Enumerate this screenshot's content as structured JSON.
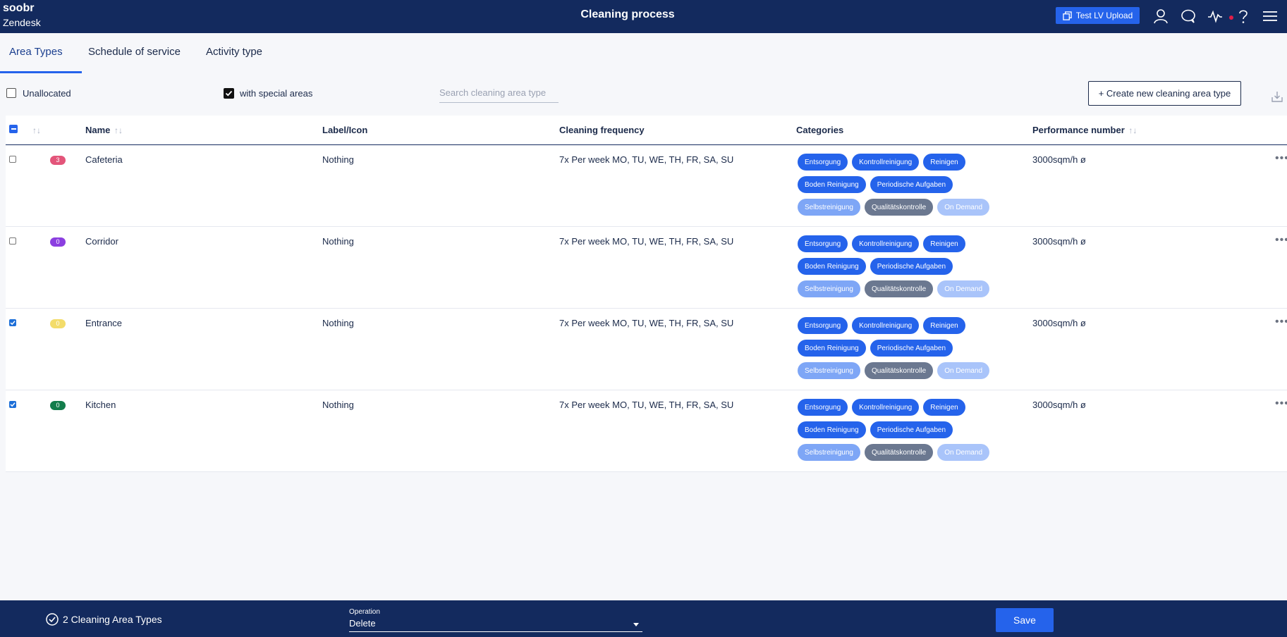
{
  "header": {
    "brand_line1": "soobr",
    "brand_line2": "Zendesk",
    "title": "Cleaning process",
    "upload_label": "Test LV Upload"
  },
  "tabs": [
    {
      "label": "Area Types",
      "active": true
    },
    {
      "label": "Schedule of service",
      "active": false
    },
    {
      "label": "Activity type",
      "active": false
    }
  ],
  "filters": {
    "unallocated_label": "Unallocated",
    "unallocated_checked": false,
    "special_label": "with special areas",
    "special_checked": true,
    "search_placeholder": "Search cleaning area type",
    "create_label": "+ Create new cleaning area type"
  },
  "table": {
    "columns": {
      "name": "Name",
      "label_icon": "Label/Icon",
      "frequency": "Cleaning frequency",
      "categories": "Categories",
      "performance": "Performance number"
    },
    "rows": [
      {
        "checked": false,
        "count": "3",
        "count_color": "#e3557a",
        "name": "Cafeteria",
        "label": "Nothing",
        "frequency": "7x Per week MO, TU, WE, TH, FR, SA, SU",
        "performance": "3000sqm/h ø",
        "categories": [
          "Entsorgung",
          "Kontrollreinigung",
          "Reinigen",
          "Boden Reinigung",
          "Periodische Aufgaben",
          "Selbstreinigung",
          "Qualitätskontrolle",
          "On Demand"
        ]
      },
      {
        "checked": false,
        "count": "0",
        "count_color": "#8b3fe0",
        "name": "Corridor",
        "label": "Nothing",
        "frequency": "7x Per week MO, TU, WE, TH, FR, SA, SU",
        "performance": "3000sqm/h ø",
        "categories": [
          "Entsorgung",
          "Kontrollreinigung",
          "Reinigen",
          "Boden Reinigung",
          "Periodische Aufgaben",
          "Selbstreinigung",
          "Qualitätskontrolle",
          "On Demand"
        ]
      },
      {
        "checked": true,
        "count": "0",
        "count_color": "#f3dc6a",
        "name": "Entrance",
        "label": "Nothing",
        "frequency": "7x Per week MO, TU, WE, TH, FR, SA, SU",
        "performance": "3000sqm/h ø",
        "categories": [
          "Entsorgung",
          "Kontrollreinigung",
          "Reinigen",
          "Boden Reinigung",
          "Periodische Aufgaben",
          "Selbstreinigung",
          "Qualitätskontrolle",
          "On Demand"
        ]
      },
      {
        "checked": true,
        "count": "0",
        "count_color": "#137d4c",
        "name": "Kitchen",
        "label": "Nothing",
        "frequency": "7x Per week MO, TU, WE, TH, FR, SA, SU",
        "performance": "3000sqm/h ø",
        "categories": [
          "Entsorgung",
          "Kontrollreinigung",
          "Reinigen",
          "Boden Reinigung",
          "Periodische Aufgaben",
          "Selbstreinigung",
          "Qualitätskontrolle",
          "On Demand"
        ]
      }
    ]
  },
  "footer": {
    "selection_text": "2 Cleaning Area Types",
    "operation_label": "Operation",
    "operation_value": "Delete",
    "save_label": "Save"
  },
  "colors": {
    "nav": "#132a5e",
    "accent": "#2563eb"
  }
}
